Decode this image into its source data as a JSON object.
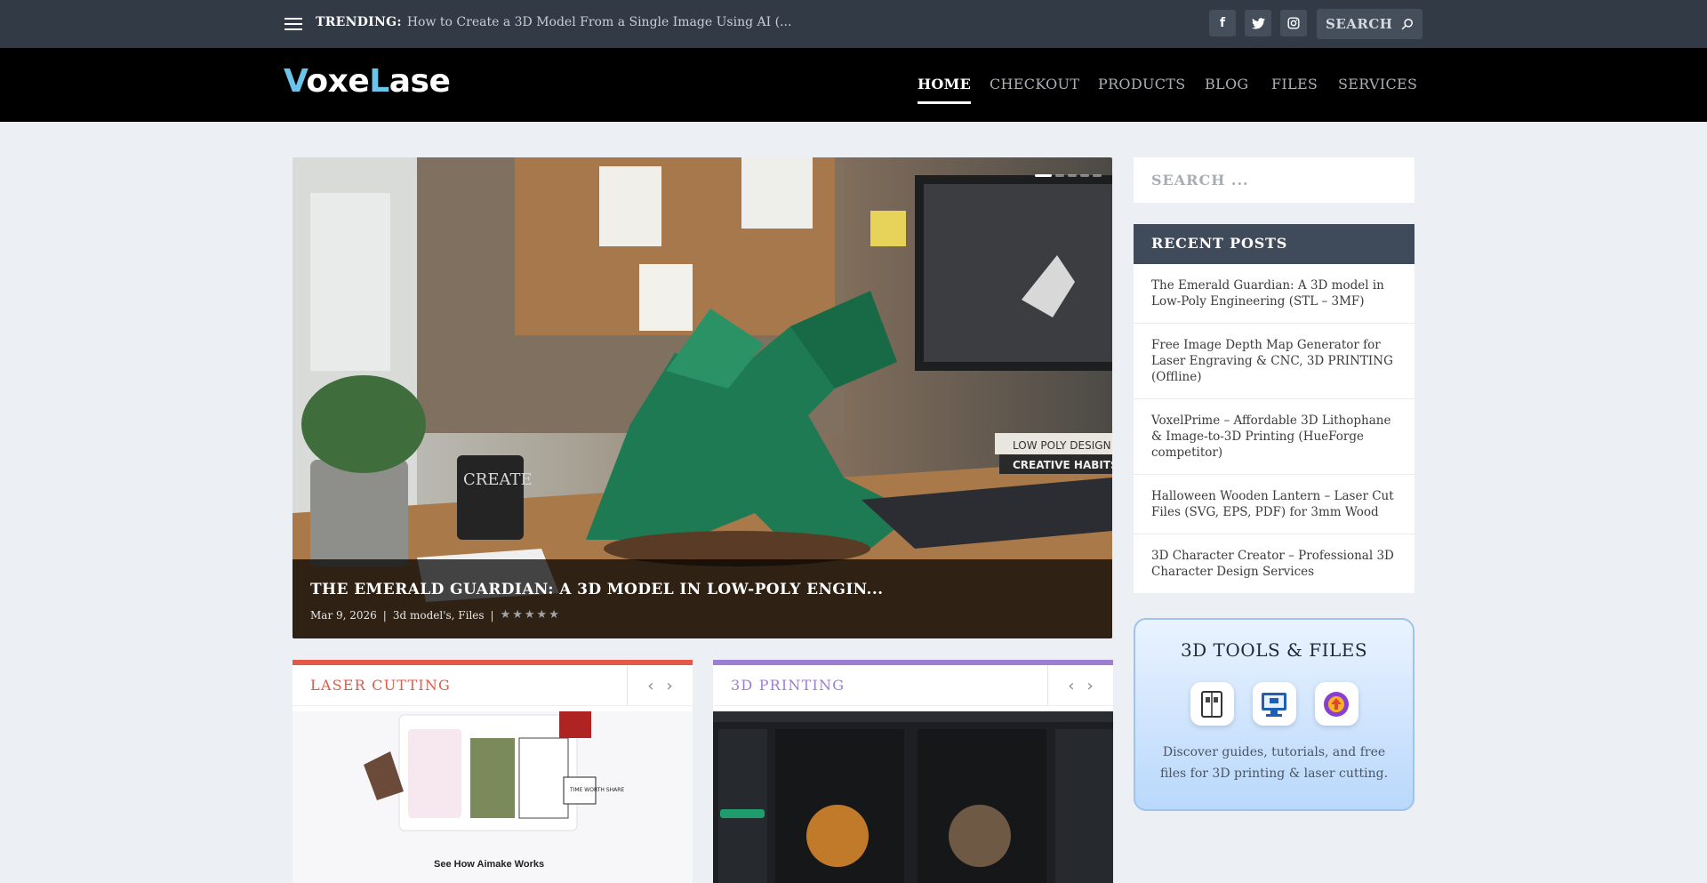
{
  "topbar": {
    "trending_label": "TRENDING:",
    "trending_text": "How to Create a 3D Model From a Single Image Using AI (...",
    "search_placeholder": "SEARCH",
    "social": [
      "facebook-icon",
      "twitter-icon",
      "instagram-icon"
    ]
  },
  "header": {
    "logo": {
      "part1": "V",
      "part2": "oxe",
      "part3": "L",
      "part4": "ase"
    },
    "nav": [
      "HOME",
      "CHECKOUT",
      "PRODUCTS",
      "BLOG",
      "FILES",
      "SERVICES"
    ],
    "active_nav": "HOME"
  },
  "hero": {
    "title": "THE EMERALD GUARDIAN: A 3D MODEL IN LOW-POLY ENGIN...",
    "date": "Mar 9, 2026",
    "sep": "|",
    "categories": "3d model's, Files",
    "rating_stars": "★★★★★",
    "slide_count": 5,
    "active_slide": 1,
    "image_text": {
      "mug": "CREATE",
      "book1": "LOW POLY DESIGN",
      "book2": "CREATIVE HABITS"
    }
  },
  "sections": {
    "laser": {
      "title": "LASER CUTTING",
      "image_caption": "See How Aimake Works",
      "image_badge": "TIME WORTH SHARE",
      "color": "#e25a47"
    },
    "printing": {
      "title": "3D PRINTING",
      "color": "#9b7fd2"
    },
    "arrows": {
      "prev": "‹",
      "next": "›"
    }
  },
  "sidebar": {
    "search_placeholder": "SEARCH ...",
    "recent_title": "RECENT POSTS",
    "recent_posts": [
      "The Emerald Guardian: A 3D model in Low-Poly Engineering (STL – 3MF)",
      "Free Image Depth Map Generator for Laser Engraving & CNC, 3D PRINTING (Offline)",
      "VoxelPrime – Affordable 3D Lithophane & Image-to-3D Printing (HueForge competitor)",
      "Halloween Wooden Lantern – Laser Cut Files (SVG, EPS, PDF) for 3mm Wood",
      "3D Character Creator – Professional 3D Character Design Services"
    ],
    "tools_title": "3D TOOLS & FILES",
    "tools_desc": "Discover guides, tutorials, and free files for 3D printing & laser cutting.",
    "tool_icons": [
      "book-icon",
      "printer-monitor-icon",
      "upload-icon"
    ]
  },
  "colors": {
    "topbar": "#323a45",
    "header": "#000000",
    "logo_accent": "#6cc4ea",
    "recent_head": "#3f4a5a"
  }
}
